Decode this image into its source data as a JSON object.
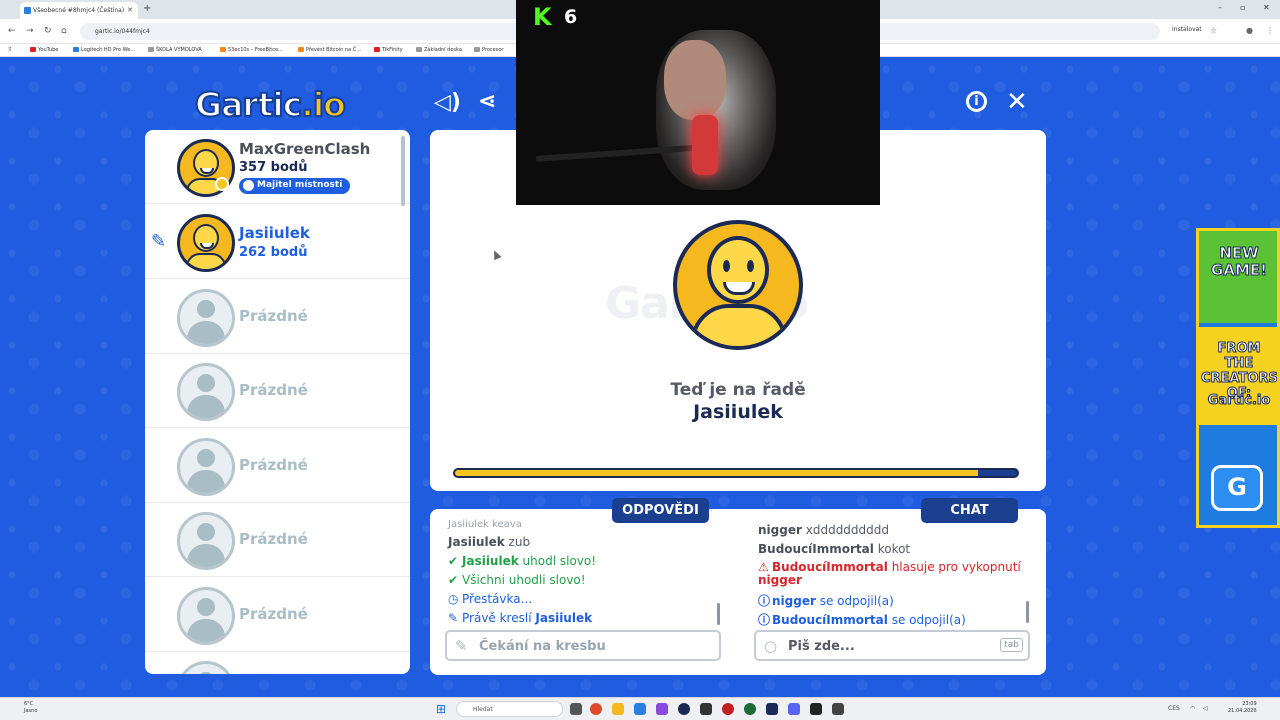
{
  "browser": {
    "tab_title": "Všeobecné #8hmjc4 (Čeština)",
    "url": "gartic.io/044fmjc4",
    "install_label": "Instalovat",
    "bookmarks": [
      "YouTube",
      "Logitech HD Pro We...",
      "ŠKOLA VÝMOLOVA",
      "53ec10s – FreeBitco...",
      "Převést Bitcoin na Č...",
      "TikFinity",
      "Základní deska",
      "Procesor"
    ]
  },
  "game": {
    "logo_text": "Gartic",
    "logo_suffix": ".io",
    "players": [
      {
        "name": "MaxGreenClash",
        "points": "357 bodů",
        "badge": "Majitel místnosti",
        "state": "owner"
      },
      {
        "name": "Jasiiulek",
        "points": "262 bodů",
        "state": "drawing"
      },
      {
        "name": "Prázdné",
        "state": "empty"
      },
      {
        "name": "Prázdné",
        "state": "empty"
      },
      {
        "name": "Prázdné",
        "state": "empty"
      },
      {
        "name": "Prázdné",
        "state": "empty"
      },
      {
        "name": "Prázdné",
        "state": "empty"
      }
    ],
    "board": {
      "turn_line": "Teď je na řadě",
      "turn_player": "Jasiiulek",
      "watermark": "Gartic.io",
      "progress": 0.93
    },
    "answers": {
      "tab_label": "ODPOVĚDI",
      "partial_top": "Jasiiulek keava",
      "messages": [
        {
          "user": "Jasiiulek",
          "text": "zub",
          "kind": "normal",
          "icon": ""
        },
        {
          "user": "Jasiiulek",
          "text": "uhodl slovo!",
          "kind": "green",
          "icon": "✔"
        },
        {
          "user": "",
          "text": "Všichni uhodli slovo!",
          "kind": "green",
          "icon": "✔"
        },
        {
          "user": "",
          "text": "Přestávka...",
          "kind": "blue",
          "icon": "◷"
        },
        {
          "user": "Jasiiulek",
          "text": "Právě kreslí",
          "kind": "blue",
          "icon": "✎"
        }
      ],
      "placeholder": "Čekání na kresbu"
    },
    "chat": {
      "tab_label": "CHAT",
      "messages": [
        {
          "user": "nigger",
          "text": "xdddddddddd",
          "kind": "normal"
        },
        {
          "user": "BudoucíImmortal",
          "text": "kokot",
          "kind": "normal"
        },
        {
          "user": "BudoucíImmortal",
          "text": "hlasuje pro vykopnutí",
          "extra": "nigger",
          "kind": "red",
          "icon": "⚠"
        },
        {
          "user": "nigger",
          "text": "se odpojil(a)",
          "kind": "blue",
          "icon": "ⓘ"
        },
        {
          "user": "BudoucíImmortal",
          "text": "se odpojil(a)",
          "kind": "blue",
          "icon": "ⓘ"
        }
      ],
      "placeholder": "Piš zde...",
      "tab_key": "tab"
    },
    "ad": {
      "headline": "NEW GAME!",
      "subline": "FROM THE CREATORS OF:",
      "brand": "Gartic.io",
      "icon": "G"
    }
  },
  "stream": {
    "platform_icon": "K",
    "viewer_count": "6"
  },
  "taskbar": {
    "weather_temp": "6°C",
    "weather_desc": "Jasno",
    "search_placeholder": "Hledat",
    "language": "CES",
    "time": "23:09",
    "date": "21.04.2026"
  },
  "colors": {
    "background_blue": "#1f5ce0",
    "navy": "#1a2a55",
    "accent_yellow": "#f5c51f",
    "green": "#23a04a",
    "red": "#d8262e"
  }
}
